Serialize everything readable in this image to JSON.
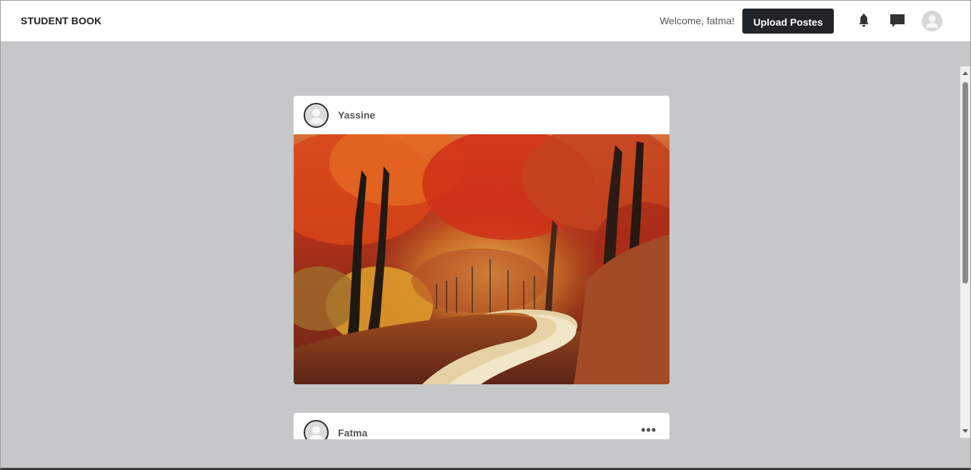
{
  "navbar": {
    "brand": "STUDENT BOOK",
    "welcome": "Welcome, fatma!",
    "upload_label": "Upload Postes",
    "icons": [
      "bell-icon",
      "chat-icon",
      "user-avatar-icon"
    ]
  },
  "posts": [
    {
      "username": "Yassine",
      "image": "autumn forest path with red and orange trees"
    },
    {
      "username": "Fatma",
      "menu": "•••"
    }
  ],
  "colors": {
    "background": "#c6c7c9",
    "navbar": "#ffffff",
    "button": "#212529",
    "text": "#555555"
  }
}
